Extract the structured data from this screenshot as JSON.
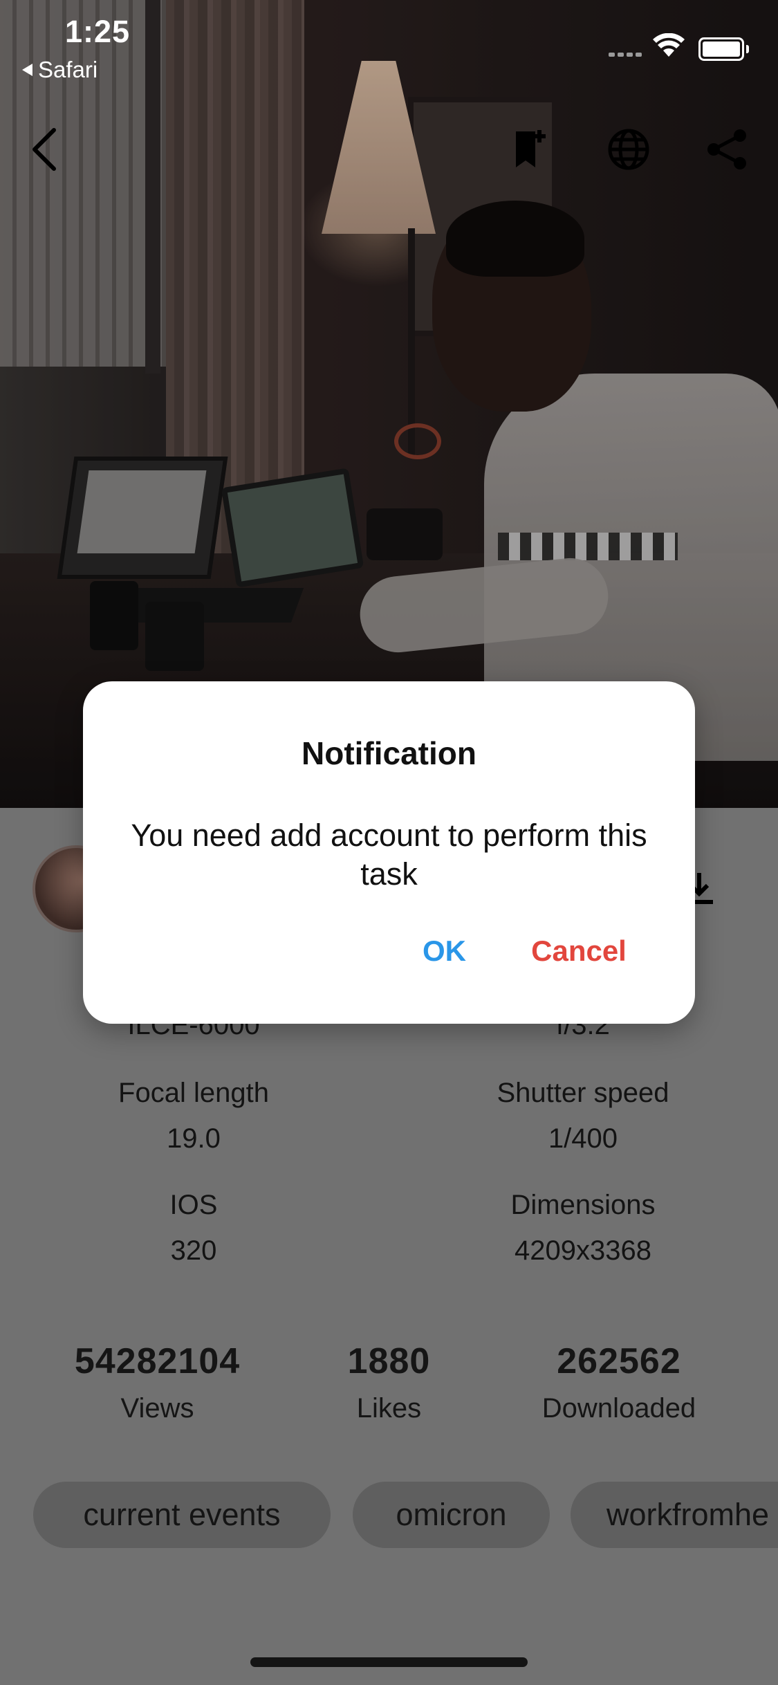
{
  "status_bar": {
    "time": "1:25",
    "back_app": "Safari"
  },
  "top_bar": {
    "icons": [
      "back-arrow-icon",
      "bookmark-add-icon",
      "globe-icon",
      "share-icon"
    ],
    "icon_color": "#000000"
  },
  "details": {
    "partial_row": {
      "left": "ILCE-6000",
      "right": "f/3.2"
    },
    "specs": [
      {
        "label": "Focal length",
        "value": "19.0"
      },
      {
        "label": "Shutter speed",
        "value": "1/400"
      },
      {
        "label": "IOS",
        "value": "320"
      },
      {
        "label": "Dimensions",
        "value": "4209x3368"
      }
    ]
  },
  "stats": [
    {
      "value": "54282104",
      "label": "Views"
    },
    {
      "value": "1880",
      "label": "Likes"
    },
    {
      "value": "262562",
      "label": "Downloaded"
    }
  ],
  "tags": [
    "current events",
    "omicron",
    "workfromhe"
  ],
  "dialog": {
    "title": "Notification",
    "message": "You need add account to perform this task",
    "ok_label": "OK",
    "cancel_label": "Cancel",
    "ok_color": "#2a96e8",
    "cancel_color": "#e2463d"
  }
}
